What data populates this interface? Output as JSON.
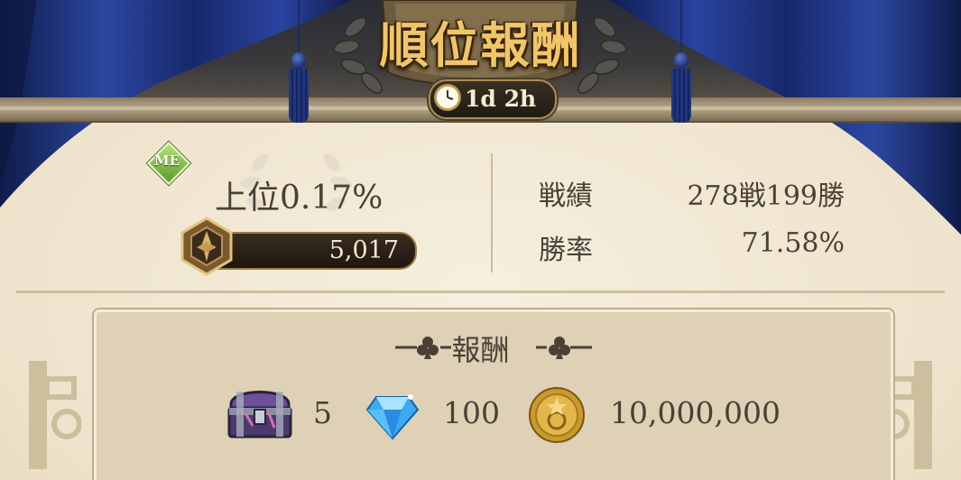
{
  "header": {
    "title": "順位報酬",
    "timer": "1d 2h"
  },
  "player": {
    "badge": "ME",
    "rank_text": "上位0.17%",
    "points": "5,017"
  },
  "stats": {
    "record_label": "戦績",
    "record_value": "278戦199勝",
    "winrate_label": "勝率",
    "winrate_value": "71.58%"
  },
  "rewards": {
    "title": "報酬",
    "items": [
      {
        "icon": "treasure-chest-icon",
        "amount": "5"
      },
      {
        "icon": "blue-diamond-icon",
        "amount": "100"
      },
      {
        "icon": "gold-coin-icon",
        "amount": "10,000,000"
      }
    ]
  },
  "colors": {
    "curtain": "#1c2f72",
    "title_gold": "#f0c56c",
    "parchment": "#efe6d2",
    "text_brown": "#4a4036"
  }
}
